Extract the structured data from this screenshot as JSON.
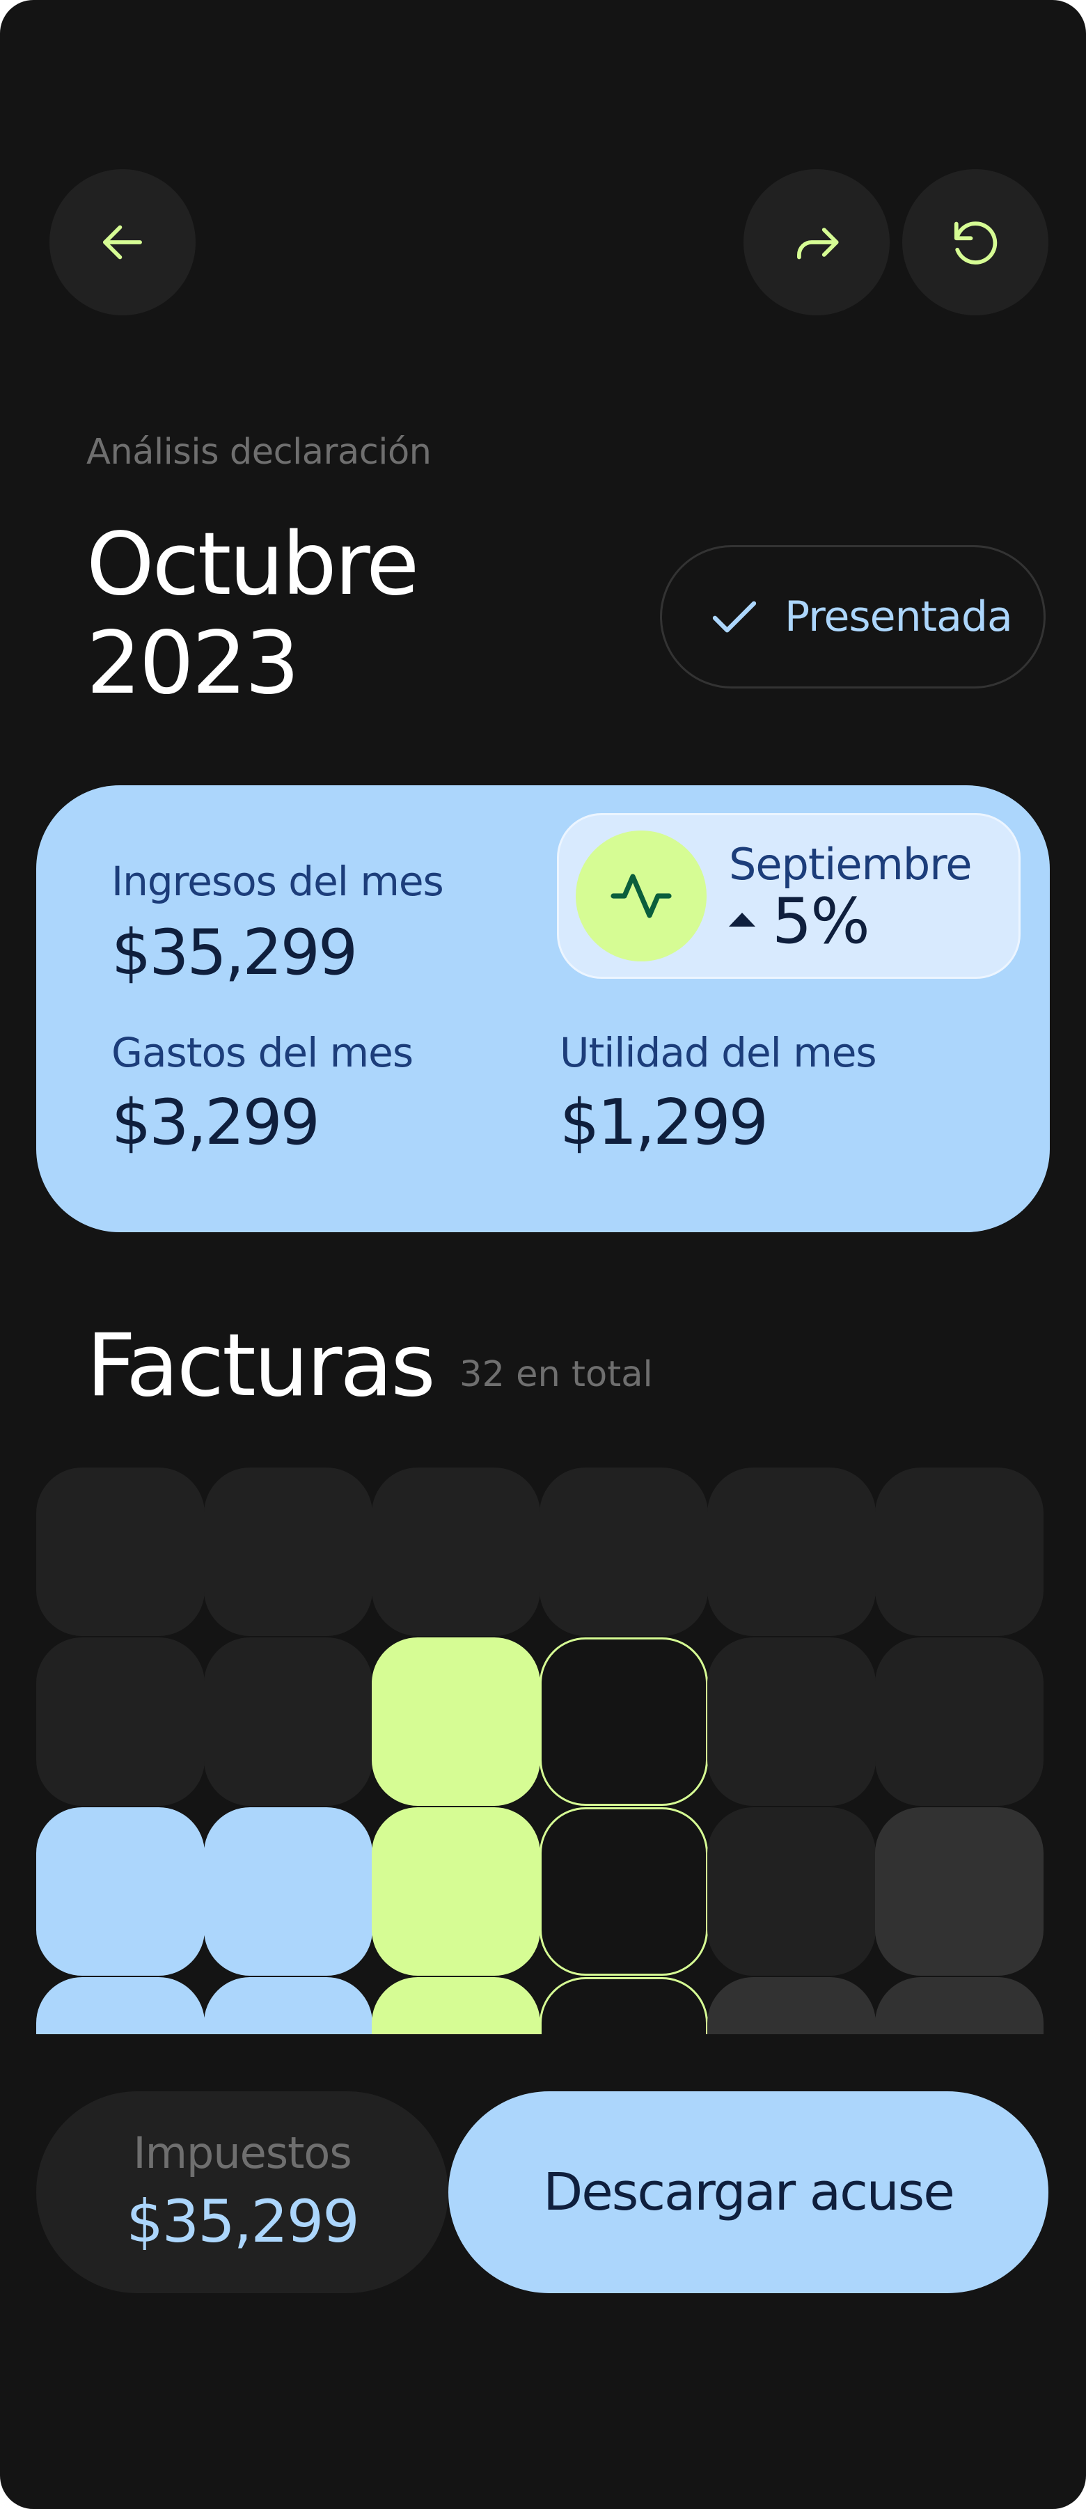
{
  "colors": {
    "background": "#141414",
    "accent_lime": "#d6fc94",
    "accent_blue": "#acd6fc",
    "surface": "#212121"
  },
  "toolbar": {
    "back_icon": "arrow-left-icon",
    "share_icon": "share-forward-icon",
    "refresh_icon": "refresh-icon"
  },
  "header": {
    "subtitle": "Análisis declaración",
    "title_line1": "Octubre",
    "title_line2": "2023",
    "status_label": "Presentada",
    "status_icon": "check-icon"
  },
  "summary": {
    "income_label": "Ingresos del mes",
    "income_value": "$35,299",
    "expenses_label": "Gastos del mes",
    "expenses_value": "$3,299",
    "profit_label": "Utilidad del mes",
    "profit_value": "$1,299",
    "comparison": {
      "icon": "activity-pulse-icon",
      "label": "Septiembre",
      "trend": "up",
      "value": "5%"
    }
  },
  "invoices": {
    "title": "Facturas",
    "count_label": "32 en total",
    "grid_colors": [
      [
        "dark",
        "dark",
        "dark",
        "dark",
        "dark",
        "dark"
      ],
      [
        "dark",
        "dark",
        "lime",
        "outline",
        "dark",
        "dark"
      ],
      [
        "blue",
        "blue",
        "lime",
        "outline",
        "dark",
        "gray"
      ],
      [
        "blue",
        "blue",
        "lime",
        "outline",
        "gray",
        "gray"
      ]
    ]
  },
  "footer": {
    "tax_label": "Impuestos",
    "tax_value": "$35,299",
    "download_label": "Descargar acuse"
  }
}
